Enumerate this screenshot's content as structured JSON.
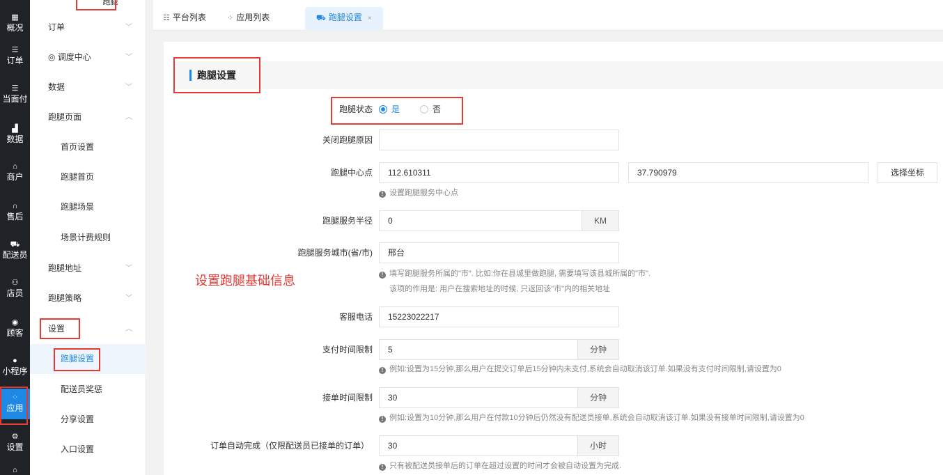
{
  "rail": [
    {
      "icon": "grid-icon",
      "glyph": "▦",
      "label": "概况"
    },
    {
      "icon": "list-icon",
      "glyph": "☰",
      "label": "订单"
    },
    {
      "icon": "list-icon",
      "glyph": "☰",
      "label": "当面付"
    },
    {
      "icon": "bar-chart-icon",
      "glyph": "▟",
      "label": "数据"
    },
    {
      "icon": "store-icon",
      "glyph": "⌂",
      "label": "商户"
    },
    {
      "icon": "headset-icon",
      "glyph": "∩",
      "label": "售后"
    },
    {
      "icon": "truck-icon",
      "glyph": "⛟",
      "label": "配送员"
    },
    {
      "icon": "users-icon",
      "glyph": "⚇",
      "label": "店员"
    },
    {
      "icon": "customer-icon",
      "glyph": "◉",
      "label": "顾客"
    },
    {
      "icon": "wechat-icon",
      "glyph": "●",
      "label": "小程序"
    },
    {
      "icon": "apps-icon",
      "glyph": "⁘",
      "label": "应用"
    },
    {
      "icon": "settings-icon",
      "glyph": "⚙",
      "label": "设置"
    },
    {
      "icon": "lock-icon",
      "glyph": "⌂",
      "label": ""
    }
  ],
  "submenu": {
    "top_cut": "跑腿",
    "items": [
      {
        "label": "订单",
        "arrow": "﹀",
        "child": false
      },
      {
        "label": "◎ 调度中心",
        "arrow": "﹀",
        "child": false
      },
      {
        "label": "数据",
        "arrow": "﹀",
        "child": false
      },
      {
        "label": "跑腿页面",
        "arrow": "︿",
        "child": false
      },
      {
        "label": "首页设置",
        "arrow": "",
        "child": true
      },
      {
        "label": "跑腿首页",
        "arrow": "",
        "child": true
      },
      {
        "label": "跑腿场景",
        "arrow": "",
        "child": true
      },
      {
        "label": "场景计费规则",
        "arrow": "",
        "child": true
      },
      {
        "label": "跑腿地址",
        "arrow": "﹀",
        "child": false
      },
      {
        "label": "跑腿策略",
        "arrow": "﹀",
        "child": false
      },
      {
        "label": "设置",
        "arrow": "︿",
        "child": false
      },
      {
        "label": "跑腿设置",
        "arrow": "",
        "child": true
      },
      {
        "label": "配送员奖惩",
        "arrow": "",
        "child": true
      },
      {
        "label": "分享设置",
        "arrow": "",
        "child": true
      },
      {
        "label": "入口设置",
        "arrow": "",
        "child": true
      }
    ]
  },
  "tabs": [
    {
      "icon": "list-icon",
      "glyph": "☷",
      "label": "平台列表"
    },
    {
      "icon": "apps-icon",
      "glyph": "⁘",
      "label": "应用列表"
    },
    {
      "icon": "truck-icon",
      "glyph": "⛟",
      "label": "跑腿设置",
      "close": "×"
    }
  ],
  "panel": {
    "title": "跑腿设置"
  },
  "annotation": "设置跑腿基础信息",
  "form": {
    "status_label": "跑腿状态",
    "status_yes": "是",
    "status_no": "否",
    "close_reason_label": "关闭跑腿原因",
    "close_reason_value": "",
    "center_label": "跑腿中心点",
    "center_lng": "112.610311",
    "center_lat": "37.790979",
    "pick_coord_button": "选择坐标",
    "center_hint": "设置跑腿服务中心点",
    "radius_label": "跑腿服务半径",
    "radius_value": "0",
    "radius_unit": "KM",
    "city_label": "跑腿服务城市(省/市)",
    "city_value": "邢台",
    "city_hint_1": "填写跑腿服务所属的\"市\". 比如:你在县城里做跑腿, 需要填写该县城所属的\"市\".",
    "city_hint_2": "该项的作用是: 用户在搜索地址的时候, 只返回该\"市\"内的相关地址",
    "phone_label": "客服电话",
    "phone_value": "15223022217",
    "pay_limit_label": "支付时间限制",
    "pay_limit_value": "5",
    "pay_limit_unit": "分钟",
    "pay_limit_hint": "例如:设置为15分钟,那么用户在提交订单后15分钟内未支付,系统会自动取消该订单.如果没有支付时间限制,请设置为0",
    "accept_limit_label": "接单时间限制",
    "accept_limit_value": "30",
    "accept_limit_unit": "分钟",
    "accept_limit_hint": "例如:设置为10分钟,那么用户在付款10分钟后仍然没有配送员接单,系统会自动取消该订单.如果没有接单时间限制,请设置为0",
    "auto_complete_label": "订单自动完成（仅限配送员已接单的订单）",
    "auto_complete_value": "30",
    "auto_complete_unit": "小时",
    "auto_complete_hint": "只有被配送员接单后的订单在超过设置的时间才会被自动设置为完成."
  },
  "colors": {
    "accent": "#1e88e5",
    "highlight_box": "#e53935",
    "rail_bg": "#1f2328"
  }
}
